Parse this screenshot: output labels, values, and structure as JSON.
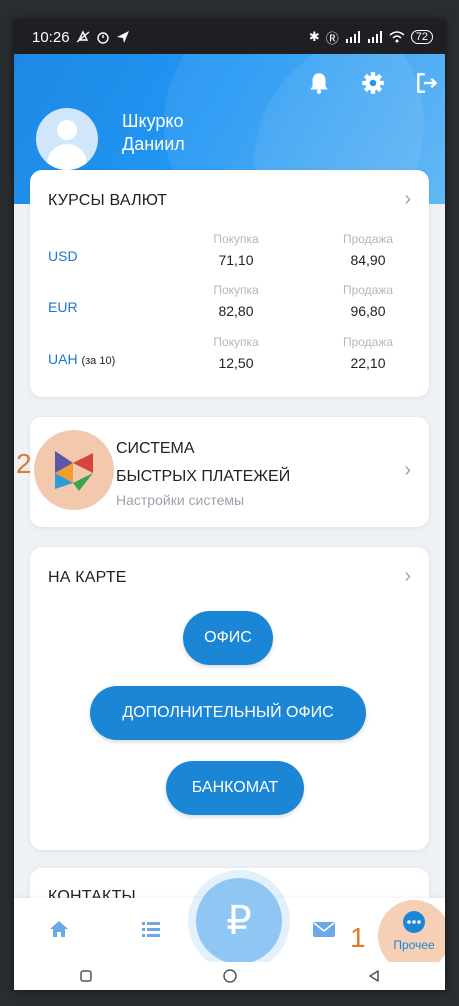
{
  "status_bar": {
    "time": "10:26",
    "icons_left": [
      "mute-icon",
      "alarm-icon",
      "location-icon"
    ],
    "icons_right": [
      "bluetooth-icon",
      "r-icon",
      "signal-icon",
      "signal-icon",
      "wifi-icon"
    ],
    "battery": "72"
  },
  "header": {
    "user_name": "Шкурко Даниил",
    "user_first_line": "Шкурко",
    "user_second_line": "Даниил",
    "icons": [
      "bell-icon",
      "gear-icon",
      "logout-icon"
    ]
  },
  "rates": {
    "title": "КУРСЫ ВАЛЮТ",
    "buy_label": "Покупка",
    "sell_label": "Продажа",
    "rows": [
      {
        "currency": "USD",
        "note": "",
        "buy": "71,10",
        "sell": "84,90"
      },
      {
        "currency": "EUR",
        "note": "",
        "buy": "82,80",
        "sell": "96,80"
      },
      {
        "currency": "UAH",
        "note": "(за 10)",
        "buy": "12,50",
        "sell": "22,10"
      }
    ]
  },
  "sbp": {
    "title_line1": "СИСТЕМА",
    "title_line2": "БЫСТРЫХ ПЛАТЕЖЕЙ",
    "subtitle": "Настройки системы",
    "annotation": "2"
  },
  "map": {
    "title": "НА КАРТЕ",
    "buttons": [
      "ОФИС",
      "ДОПОЛНИТЕЛЬНЫЙ ОФИС",
      "БАНКОМАТ"
    ]
  },
  "contacts": {
    "title": "КОНТАКТЫ"
  },
  "bottom_nav": {
    "items": [
      "home-icon",
      "list-icon",
      "ruble-icon",
      "mail-icon",
      "more-icon"
    ],
    "more_label": "Прочее",
    "ruble_symbol": "₽",
    "annotation": "1"
  },
  "colors": {
    "accent": "#1c86d6",
    "highlight": "#f3c9ad",
    "annotation": "#e07a2d"
  }
}
